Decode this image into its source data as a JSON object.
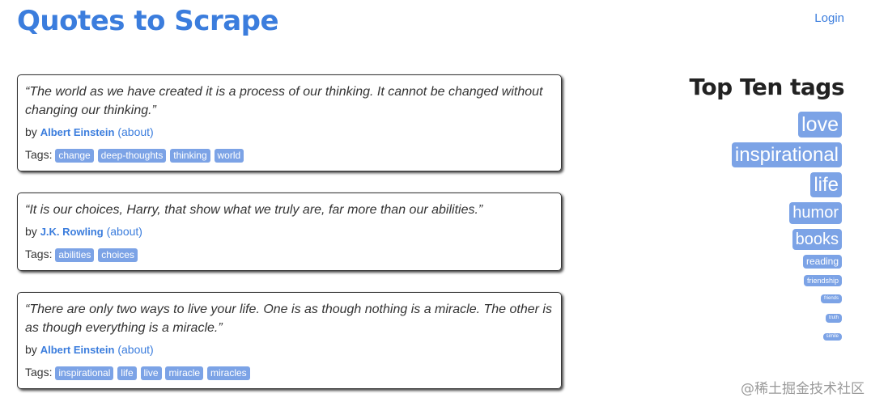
{
  "header": {
    "title": "Quotes to Scrape",
    "login_label": "Login"
  },
  "quotes": [
    {
      "text": "“The world as we have created it is a process of our thinking. It cannot be changed without changing our thinking.”",
      "by_label": "by",
      "author": "Albert Einstein",
      "about_label": "(about)",
      "tags_label": "Tags:",
      "tags": [
        "change",
        "deep-thoughts",
        "thinking",
        "world"
      ]
    },
    {
      "text": "“It is our choices, Harry, that show what we truly are, far more than our abilities.”",
      "by_label": "by",
      "author": "J.K. Rowling",
      "about_label": "(about)",
      "tags_label": "Tags:",
      "tags": [
        "abilities",
        "choices"
      ]
    },
    {
      "text": "“There are only two ways to live your life. One is as though nothing is a miracle. The other is as though everything is a miracle.”",
      "by_label": "by",
      "author": "Albert Einstein",
      "about_label": "(about)",
      "tags_label": "Tags:",
      "tags": [
        "inspirational",
        "life",
        "live",
        "miracle",
        "miracles"
      ]
    }
  ],
  "sidebar": {
    "title": "Top Ten tags",
    "tags": [
      {
        "label": "love",
        "size": "xl"
      },
      {
        "label": "inspirational",
        "size": "xl"
      },
      {
        "label": "life",
        "size": "xl"
      },
      {
        "label": "humor",
        "size": "l"
      },
      {
        "label": "books",
        "size": "l"
      },
      {
        "label": "reading",
        "size": "s"
      },
      {
        "label": "friendship",
        "size": "xs"
      },
      {
        "label": "friends",
        "size": "xxs"
      },
      {
        "label": "truth",
        "size": "xxs"
      },
      {
        "label": "simile",
        "size": "xxs"
      }
    ]
  },
  "watermark": "@稀土掘金技术社区",
  "colors": {
    "accent": "#3b7ddd",
    "tag_bg": "#7ca3e6"
  }
}
